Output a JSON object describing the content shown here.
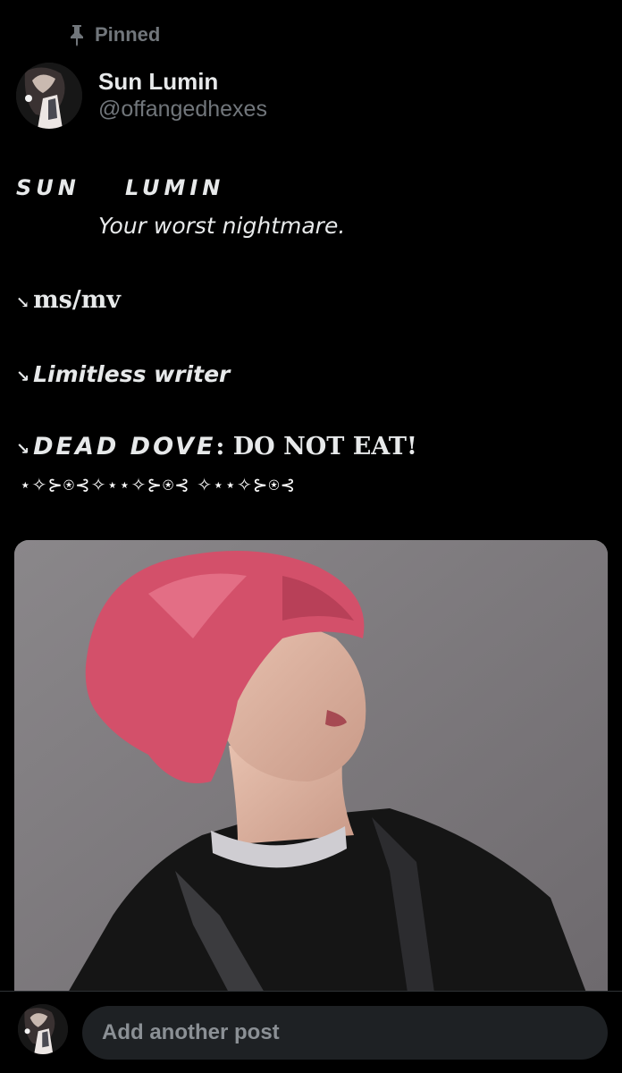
{
  "pinned": {
    "label": "Pinned",
    "icon": "pin-icon"
  },
  "author": {
    "name": "Sun Lumin",
    "handle": "@offangedhexes"
  },
  "post": {
    "title_part1": "SUN",
    "title_part2": "LUMIN",
    "subtitle": "Your worst nightmare.",
    "arrow": "↘",
    "bio_line1": "ms/mv",
    "bio_line2": "Limitless writer",
    "bio_line3_italic": "DEAD DOVE",
    "bio_line3_rest": ": DO NOT EAT!",
    "ornament": "⋆✧⊱⍟⊰✧⋆⋆✧⊱⍟⊰ ✧⋆⋆✧⊱⍟⊰"
  },
  "media": {
    "type": "photo"
  },
  "composer": {
    "placeholder": "Add another post"
  },
  "colors": {
    "background": "#000000",
    "primary_text": "#e7e9ea",
    "secondary_text": "#71767b",
    "input_background": "#1e2124",
    "hair": "#d3506a"
  }
}
